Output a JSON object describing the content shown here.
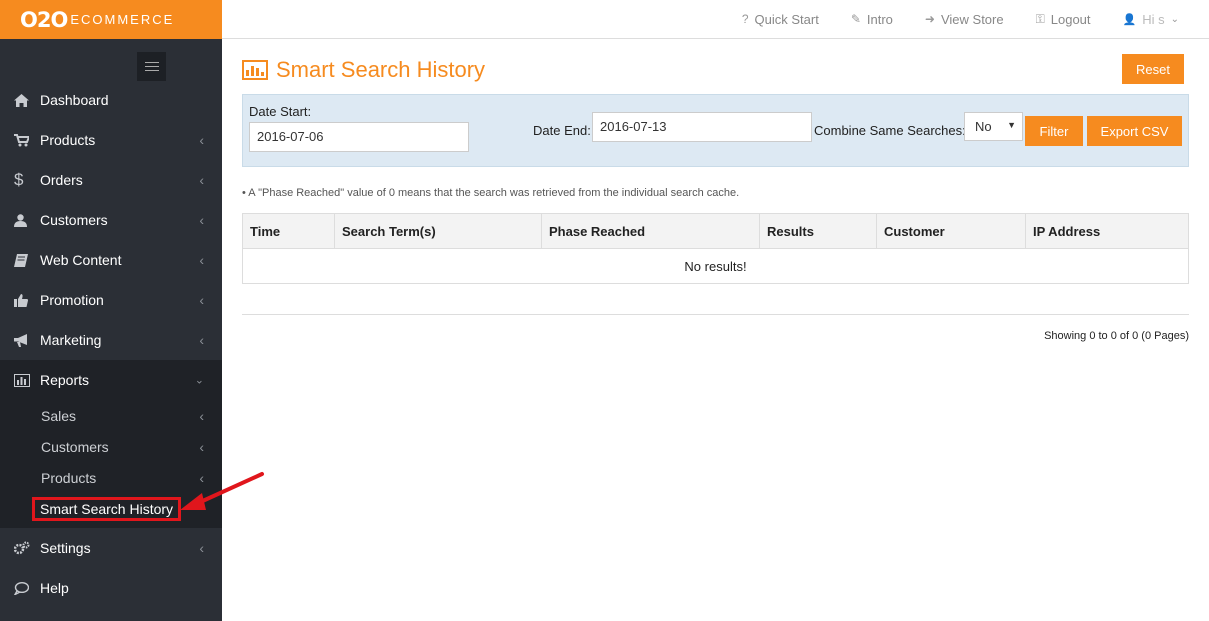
{
  "logo": {
    "main": "O2O",
    "sub": "ECOMMERCE"
  },
  "topbar": {
    "links": [
      {
        "icon": "?",
        "label": "Quick Start"
      },
      {
        "icon": "✎",
        "label": "Intro"
      },
      {
        "icon": "➜",
        "label": "View Store"
      },
      {
        "icon": "⚿",
        "label": "Logout"
      },
      {
        "icon": "👤",
        "label": "Hi s"
      }
    ]
  },
  "sidebar": {
    "items": [
      {
        "label": "Dashboard",
        "icon": "home-icon"
      },
      {
        "label": "Products",
        "icon": "cart-icon"
      },
      {
        "label": "Orders",
        "icon": "dollar-icon"
      },
      {
        "label": "Customers",
        "icon": "user-icon"
      },
      {
        "label": "Web Content",
        "icon": "book-icon"
      },
      {
        "label": "Promotion",
        "icon": "thumbs-up-icon"
      },
      {
        "label": "Marketing",
        "icon": "bullhorn-icon"
      },
      {
        "label": "Reports",
        "icon": "bar-chart-icon"
      },
      {
        "label": "Settings",
        "icon": "gears-icon"
      },
      {
        "label": "Help",
        "icon": "chat-icon"
      }
    ],
    "reports_sub": [
      {
        "label": "Sales"
      },
      {
        "label": "Customers"
      },
      {
        "label": "Products"
      },
      {
        "label": "Smart Search History"
      }
    ]
  },
  "page": {
    "title": "Smart Search History",
    "reset_label": "Reset",
    "filter": {
      "date_start_label": "Date Start:",
      "date_start_value": "2016-07-06",
      "date_end_label": "Date End:",
      "date_end_value": "2016-07-13",
      "combine_label": "Combine Same Searches:",
      "combine_value": "No",
      "filter_label": "Filter",
      "export_label": "Export CSV"
    },
    "note": "• A \"Phase Reached\" value of 0 means that the search was retrieved from the individual search cache.",
    "table": {
      "headers": [
        "Time",
        "Search Term(s)",
        "Phase Reached",
        "Results",
        "Customer",
        "IP Address"
      ],
      "empty_text": "No results!"
    },
    "showing": "Showing 0 to 0 of 0 (0 Pages)"
  },
  "colors": {
    "accent": "#f68b1f",
    "sidebar": "#2b2f36",
    "highlight": "#e0161c"
  }
}
